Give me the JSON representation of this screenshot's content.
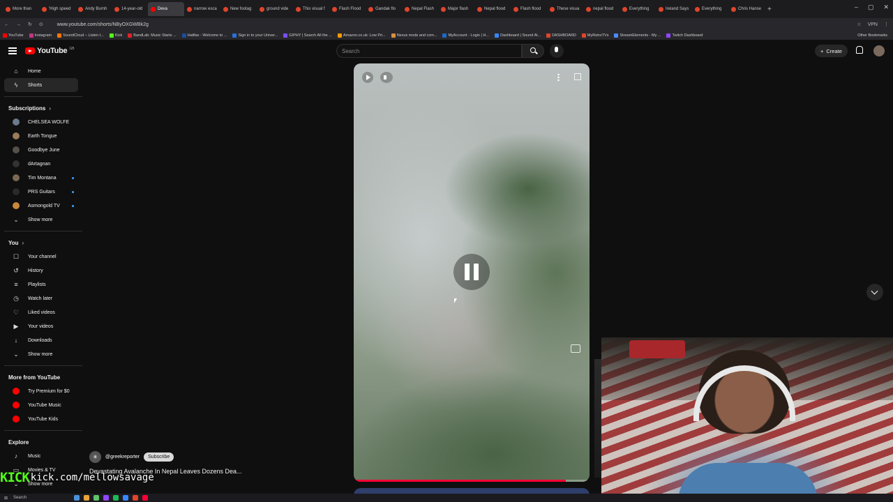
{
  "browser": {
    "tabs": [
      {
        "label": "More than",
        "color": "#e0452b"
      },
      {
        "label": "'High speed",
        "color": "#e0452b"
      },
      {
        "label": "Andy Burnh",
        "color": "#e0452b"
      },
      {
        "label": "14-year-old",
        "color": "#e0452b"
      },
      {
        "label": "Deva",
        "color": "#ff0000",
        "active": true
      },
      {
        "label": "narrow esca",
        "color": "#e0452b"
      },
      {
        "label": "New footag",
        "color": "#e0452b"
      },
      {
        "label": "ground vide",
        "color": "#e0452b"
      },
      {
        "label": "This visual f",
        "color": "#e0452b"
      },
      {
        "label": "Flash Flood",
        "color": "#e0452b"
      },
      {
        "label": "Gandak flo",
        "color": "#e0452b"
      },
      {
        "label": "Nepal Flash",
        "color": "#e0452b"
      },
      {
        "label": "Major flash",
        "color": "#e0452b"
      },
      {
        "label": "Nepal flood",
        "color": "#e0452b"
      },
      {
        "label": "Flash flood",
        "color": "#e0452b"
      },
      {
        "label": "These visua",
        "color": "#e0452b"
      },
      {
        "label": "nepal flood",
        "color": "#e0452b"
      },
      {
        "label": "Everything",
        "color": "#e0452b"
      },
      {
        "label": "Ireland Says",
        "color": "#e0452b"
      },
      {
        "label": "Everything",
        "color": "#e0452b"
      },
      {
        "label": "Chris Hanse",
        "color": "#e0452b"
      }
    ],
    "url": "www.youtube.com/shorts/NByOXGWBk2g",
    "vpn_label": "VPN",
    "bookmarks": [
      {
        "label": "YouTube",
        "color": "#ff0000"
      },
      {
        "label": "Instagram",
        "color": "#c13584"
      },
      {
        "label": "SoundCloud – Listen t...",
        "color": "#ff7700"
      },
      {
        "label": "Kick",
        "color": "#53fc18"
      },
      {
        "label": "BandLab: Music Starts ...",
        "color": "#e2222a"
      },
      {
        "label": "Halifax - Welcome to ...",
        "color": "#1a4ea1"
      },
      {
        "label": "Sign in to your Univer...",
        "color": "#2a6fdb"
      },
      {
        "label": "GIPHY | Search All the ...",
        "color": "#7b4fff"
      },
      {
        "label": "Amazon.co.uk: Low Pri...",
        "color": "#ff9900"
      },
      {
        "label": "Nexus mods and com...",
        "color": "#d98f40"
      },
      {
        "label": "MyAccount - Login | H...",
        "color": "#1b6ac9"
      },
      {
        "label": "Dashboard | Sound Al...",
        "color": "#3a86ff"
      },
      {
        "label": "DASHBOARD",
        "color": "#e0452b"
      },
      {
        "label": "MyRetroTVs",
        "color": "#e0452b"
      },
      {
        "label": "StreamElements - My ...",
        "color": "#4a8cff"
      },
      {
        "label": "Twitch Dashboard",
        "color": "#9146ff"
      }
    ],
    "other_bookmarks": "Other Bookmarks"
  },
  "youtube": {
    "logo_text": "YouTube",
    "logo_region": "GB",
    "search_placeholder": "Search",
    "create_label": "Create",
    "nav": [
      {
        "label": "Home",
        "icon": "⌂"
      },
      {
        "label": "Shorts",
        "icon": "ϟ",
        "active": true
      }
    ],
    "subscriptions_heading": "Subscriptions",
    "subscriptions": [
      {
        "label": "CHELSEA WOLFE",
        "color": "#6b7a8c",
        "live": false
      },
      {
        "label": "Earth Tongue",
        "color": "#9a7b5a",
        "live": false
      },
      {
        "label": "Goodbye June",
        "color": "#55504a",
        "live": false
      },
      {
        "label": "dArtagnan",
        "color": "#333",
        "live": false
      },
      {
        "label": "Tim Montana",
        "color": "#7a6852",
        "live": true
      },
      {
        "label": "PRS Guitars",
        "color": "#2a2a2a",
        "live": true
      },
      {
        "label": "Asmongold TV",
        "color": "#c8873a",
        "live": true
      }
    ],
    "show_more": "Show more",
    "you_heading": "You",
    "you_items": [
      {
        "label": "Your channel",
        "icon": "☐"
      },
      {
        "label": "History",
        "icon": "↺"
      },
      {
        "label": "Playlists",
        "icon": "≡"
      },
      {
        "label": "Watch later",
        "icon": "◷"
      },
      {
        "label": "Liked videos",
        "icon": "♡"
      },
      {
        "label": "Your videos",
        "icon": "▶"
      },
      {
        "label": "Downloads",
        "icon": "↓"
      }
    ],
    "you_show_more": "Show more",
    "more_heading": "More from YouTube",
    "more_items": [
      {
        "label": "Try Premium for $0",
        "color": "#ff0000"
      },
      {
        "label": "YouTube Music",
        "color": "#ff0000"
      },
      {
        "label": "YouTube Kids",
        "color": "#ff0000"
      }
    ],
    "explore_heading": "Explore",
    "explore_items": [
      {
        "label": "Music",
        "icon": "♪"
      },
      {
        "label": "Movies & TV",
        "icon": "▭"
      }
    ],
    "explore_show_more": "Show more"
  },
  "short": {
    "channel": "@greekreporter",
    "subscribe_label": "Subscribe",
    "title": "Devastating Avalanche In Nepal Leaves Dozens Dea...",
    "progress": 0.9
  },
  "overlay": {
    "kick_logo": "KICK",
    "kick_url": "kick.com/mellowsavage"
  },
  "taskbar": {
    "search_label": "Search"
  }
}
